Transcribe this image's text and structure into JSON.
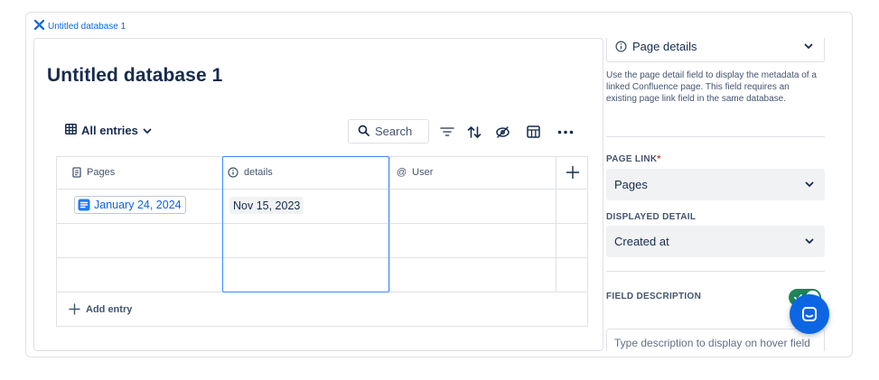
{
  "breadcrumb": {
    "label": "Untitled database 1"
  },
  "database": {
    "title": "Untitled database 1",
    "view_label": "All entries",
    "search_label": "Search"
  },
  "table": {
    "columns": [
      {
        "label": "Pages",
        "icon": "page-icon"
      },
      {
        "label": "details",
        "icon": "info-icon"
      },
      {
        "label": "User",
        "icon": "at-icon"
      }
    ],
    "rows": [
      {
        "pages": "January 24, 2024",
        "details": "Nov 15, 2023",
        "user": ""
      },
      {
        "pages": "",
        "details": "",
        "user": ""
      },
      {
        "pages": "",
        "details": "",
        "user": ""
      }
    ],
    "add_entry_label": "Add entry"
  },
  "panel": {
    "field_type": "Page details",
    "help_text": "Use the page detail field to display the metadata of a linked Confluence page. This field requires an existing page link field in the same database.",
    "page_link_label": "PAGE LINK",
    "page_link_required_mark": "*",
    "page_link_value": "Pages",
    "displayed_detail_label": "DISPLAYED DETAIL",
    "displayed_detail_value": "Created at",
    "field_description_label": "FIELD DESCRIPTION",
    "field_description_toggle_on": true,
    "description_placeholder": "Type description to display on hover field header..."
  },
  "colors": {
    "accent": "#0c66e4",
    "selection": "#388bff",
    "toggle_on": "#1f845a",
    "required": "#c9372c"
  }
}
